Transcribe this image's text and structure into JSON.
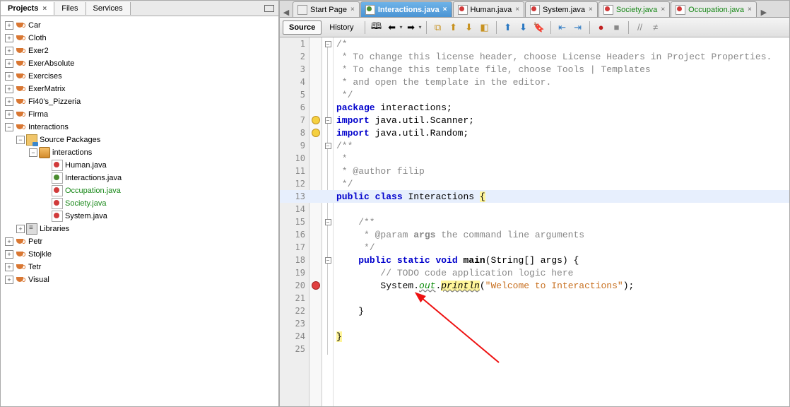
{
  "leftTabs": {
    "projects": "Projects",
    "files": "Files",
    "services": "Services"
  },
  "projects": [
    "Car",
    "Cloth",
    "Exer2",
    "ExerAbsolute",
    "Exercises",
    "ExerMatrix",
    "Fi40's_Pizzeria",
    "Firma",
    "Interactions",
    "Petr",
    "Stojkle",
    "Tetr",
    "Visual"
  ],
  "tree": {
    "sourcePackages": "Source Packages",
    "interactionsPkg": "interactions",
    "files": [
      "Human.java",
      "Interactions.java",
      "Occupation.java",
      "Society.java",
      "System.java"
    ],
    "libraries": "Libraries"
  },
  "editorTabs": [
    "Start Page",
    "Interactions.java",
    "Human.java",
    "System.java",
    "Society.java",
    "Occupation.java"
  ],
  "toolbar": {
    "source": "Source",
    "history": "History"
  },
  "code": {
    "l1": "/*",
    "l2": " * To change this license header, choose License Headers in Project Properties.",
    "l3": " * To change this template file, choose Tools | Templates",
    "l4": " * and open the template in the editor.",
    "l5": " */",
    "l6_a": "package",
    "l6_b": " interactions;",
    "l7_a": "import",
    "l7_b": " java.util.Scanner;",
    "l8_a": "import",
    "l8_b": " java.util.Random;",
    "l9": "/**",
    "l10": " *",
    "l11": " * @author filip",
    "l12": " */",
    "l13_a": "public",
    "l13_b": "class",
    "l13_c": " Interactions ",
    "l13_d": "{",
    "l15": "    /**",
    "l16_a": "     * @param ",
    "l16_b": "args",
    "l16_c": " the command line arguments",
    "l17": "     */",
    "l18_a": "public",
    "l18_b": "static",
    "l18_c": "void",
    "l18_d": "main",
    "l18_e": "(String[] args) {",
    "l19": "        // TODO code application logic here",
    "l20_a": "        System.",
    "l20_b": "out",
    "l20_c": ".",
    "l20_d": "println",
    "l20_e": "(",
    "l20_f": "\"Welcome to Interactions\"",
    "l20_g": ");",
    "l22": "    }",
    "l24": "}"
  }
}
